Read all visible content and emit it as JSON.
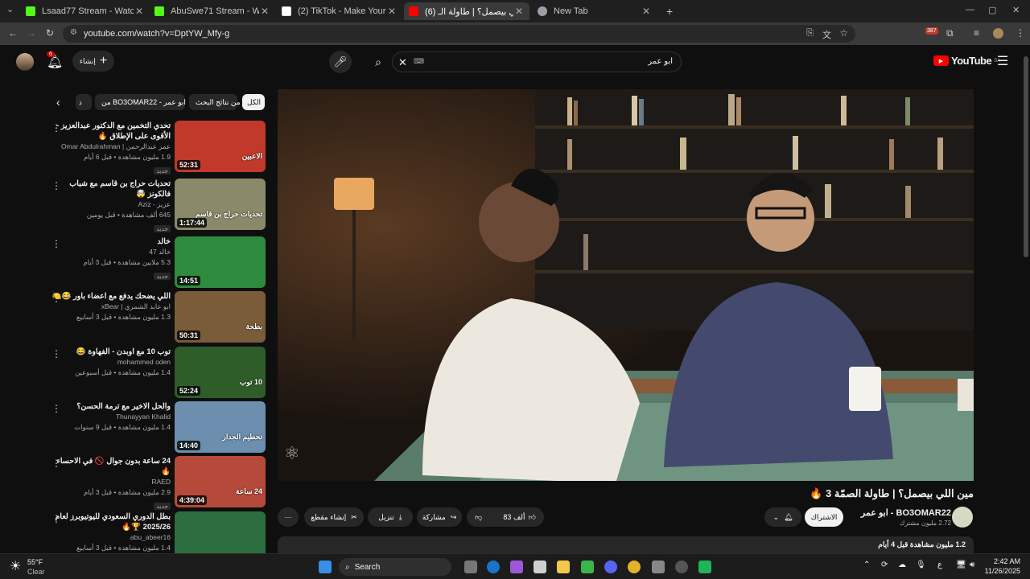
{
  "browser": {
    "tabs": [
      {
        "title": "Lsaad77 Stream - Watch Live o",
        "color": "#53fc18"
      },
      {
        "title": "AbuSwe71 Stream - Watch Live",
        "color": "#53fc18"
      },
      {
        "title": "(2) TikTok - Make Your Day",
        "color": "#ffffff"
      },
      {
        "title": "(6) مين اللي بيصمل؟ | طاولة الـ",
        "color": "#ff0000"
      },
      {
        "title": "New Tab",
        "color": "#9aa0a6"
      }
    ],
    "url": "youtube.com/watch?v=DptYW_Mfy-g",
    "extension_badge": "387"
  },
  "youtube": {
    "logo": "YouTube",
    "logo_sup": "SA",
    "search_value": "ابو عمر",
    "search_kbd": "⌨",
    "create_label": "إنشاء",
    "notification_count": "6"
  },
  "chips": [
    {
      "label": "الكل"
    },
    {
      "label": "من نتائج البحث"
    },
    {
      "label": "من BO3OMAR22 - ابو عمر"
    },
    {
      "label": "ذ"
    }
  ],
  "recommendations": [
    {
      "title": "تحدي التخمين مع الدكتور عبدالعزيز - الأقوى على الإطلاق 🔥",
      "channel": "عمر عبدالرحمن | Omar Abdulrahman",
      "meta": "1.9 مليون مشاهدة • قبل 6 أيام",
      "badge": "جديد",
      "duration": "52:31",
      "thumb": "#c0392b",
      "thumb_text": "الاعبين"
    },
    {
      "title": "تحديات حراج بن قاسم مع شباب فالكونز 🤯",
      "channel": "عزيز - Aziz",
      "meta": "645 ألف مشاهدة • قبل يومين",
      "badge": "جديد",
      "duration": "1:17:44",
      "thumb": "#8a8a6a",
      "thumb_text": "تحديات حراج بن قاسم"
    },
    {
      "title": "خالد",
      "channel": "خالد 47",
      "meta": "5.3 ملايين مشاهدة • قبل 3 أيام",
      "badge": "جديد",
      "duration": "14:51",
      "thumb": "#2e8b3d",
      "thumb_text": ""
    },
    {
      "title": "اللي يضحك يدفع مع اعضاء باور 😂🍋",
      "channel": "ابو عابد الشمري | xBear",
      "meta": "1.3 مليون مشاهدة • قبل 3 أسابيع",
      "badge": "",
      "duration": "50:31",
      "thumb": "#7a5b3a",
      "thumb_text": "بطحة"
    },
    {
      "title": "توب 10 مع اوبدن - الفهاوة 😂",
      "channel": "mohammed oden",
      "meta": "1.4 مليون مشاهدة • قبل أسبوعين",
      "badge": "",
      "duration": "52:24",
      "thumb": "#2f5d2a",
      "thumb_text": "10 توب"
    },
    {
      "title": "والحل الاخير مع ترمة الحسن؟",
      "channel": "Thunayyan Khalid",
      "meta": "1.4 مليون مشاهدة • قبل 9 سنوات",
      "badge": "",
      "duration": "14:40",
      "thumb": "#6c8fb0",
      "thumb_text": "تحطيم الجدار"
    },
    {
      "title": "24 ساعة بدون جوال 🚫 في الاحساء 🔥",
      "channel": "RAED",
      "meta": "2.9 مليون مشاهدة • قبل 3 أيام",
      "badge": "جديد",
      "duration": "4:39:04",
      "thumb": "#b64a3a",
      "thumb_text": "24 ساعة"
    },
    {
      "title": "بطل الدوري السعودي لليوتيوبرز لعام 2025/26 🏆🔥",
      "channel": "abu_abeer16",
      "meta": "1.4 مليون مشاهدة • قبل 3 أسابيع",
      "badge": "",
      "duration": "",
      "thumb": "#2c6e3f",
      "thumb_text": ""
    }
  ],
  "video": {
    "title": "مين اللي بيصمل؟ | طاولة الصمّة 3 🔥",
    "channel": "BO3OMAR22 - ابو عمر",
    "subscribers": "2.72 مليون مشترك",
    "subscribe_label": "الاشتراك",
    "likes": "83 ألف",
    "share_label": "مشاركة",
    "download_label": "تنزيل",
    "clip_label": "إنشاء مقطع",
    "views_meta": "1.2 مليون مشاهدة قبل 4 أيام"
  },
  "taskbar": {
    "weather_temp": "55°F",
    "weather_desc": "Clear",
    "search_label": "Search",
    "lang": "ع",
    "time": "2:42 AM",
    "date": "11/26/2025"
  }
}
